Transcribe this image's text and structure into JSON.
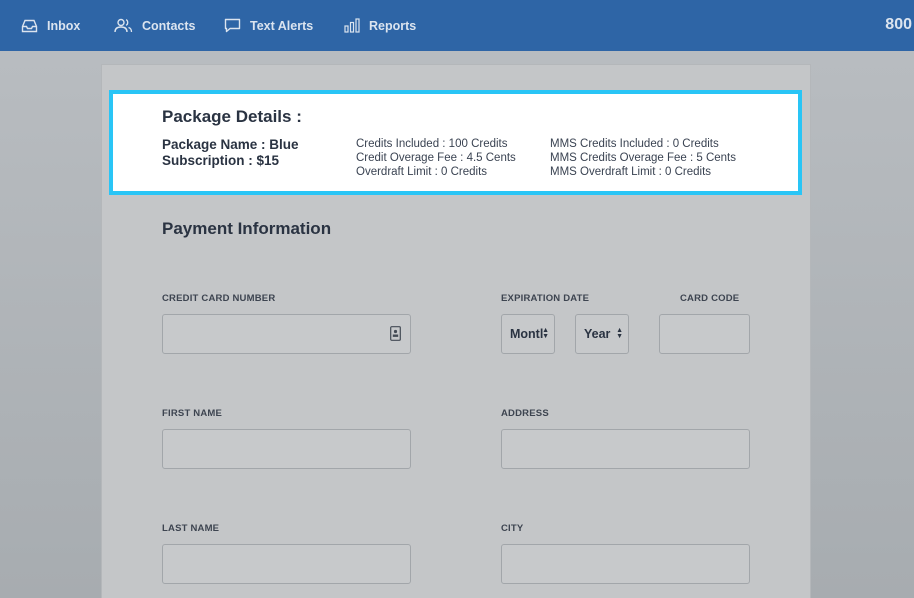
{
  "nav": {
    "items": [
      {
        "label": "Inbox",
        "icon": "inbox-icon"
      },
      {
        "label": "Contacts",
        "icon": "contacts-icon"
      },
      {
        "label": "Text Alerts",
        "icon": "chat-icon"
      },
      {
        "label": "Reports",
        "icon": "bar-chart-icon"
      }
    ],
    "right_text": "800"
  },
  "package": {
    "title": "Package Details :",
    "name": "Package Name : Blue Subscription : $15",
    "col1": [
      "Credits Included : 100 Credits",
      "Credit Overage Fee : 4.5 Cents",
      "Overdraft Limit : 0 Credits"
    ],
    "col2": [
      "MMS Credits Included : 0 Credits",
      "MMS Credits Overage Fee : 5 Cents",
      "MMS Overdraft Limit : 0 Credits"
    ]
  },
  "payment": {
    "title": "Payment Information",
    "labels": {
      "card_number": "CREDIT CARD NUMBER",
      "expiration": "EXPIRATION DATE",
      "card_code": "CARD CODE",
      "first_name": "FIRST NAME",
      "address": "ADDRESS",
      "last_name": "LAST NAME",
      "city": "CITY"
    },
    "month_select": "Montl",
    "year_select": "Year"
  },
  "colors": {
    "topbar": "#2e65a6",
    "highlight_border": "#29c5f6"
  }
}
